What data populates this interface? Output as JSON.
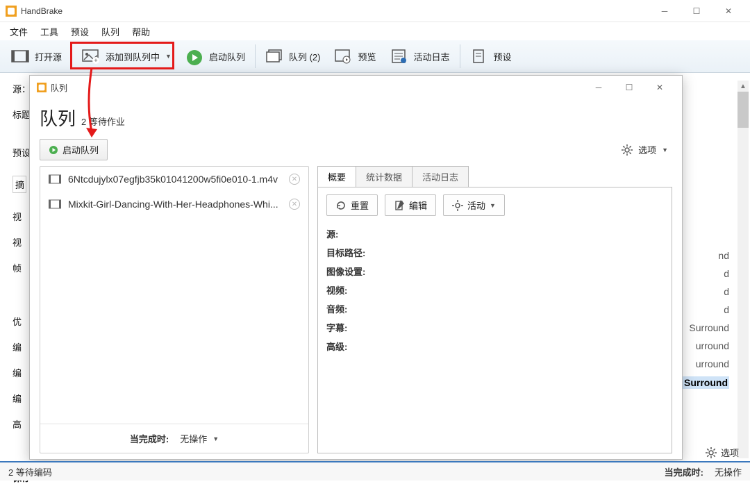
{
  "app": {
    "title": "HandBrake"
  },
  "menu": {
    "file": "文件",
    "tools": "工具",
    "presets": "预设",
    "queue": "队列",
    "help": "帮助"
  },
  "toolbar": {
    "open_source": "打开源",
    "add_to_queue": "添加到队列中",
    "start_queue": "启动队列",
    "queue_label": "队列 (2)",
    "preview": "预览",
    "activity_log": "活动日志",
    "presets": "预设"
  },
  "bg": {
    "source": "源：",
    "title": "标题",
    "preset": "预设",
    "summary_tab": "摘",
    "vid1": "视",
    "vid2": "视",
    "fps": "帧",
    "opt": "优",
    "enc1": "编",
    "enc2": "编",
    "enc3": "编",
    "adv": "高",
    "save": "保存"
  },
  "peek": [
    "nd",
    "d",
    "d",
    "d",
    "Surround",
    "urround",
    "urround",
    "Surround"
  ],
  "statusbar": {
    "pending": "2 等待编码",
    "when_done": "当完成时:",
    "action": "无操作"
  },
  "queue": {
    "window_title": "队列",
    "heading": "队列",
    "heading_sub": "2 等待作业",
    "start_btn": "启动队列",
    "options_btn": "选项",
    "items": [
      "6Ntcdujylx07egfjb35k01041200w5fi0e010-1.m4v",
      "Mixkit-Girl-Dancing-With-Her-Headphones-Whi..."
    ],
    "when_done_label": "当完成时:",
    "when_done_value": "无操作",
    "tabs": {
      "summary": "概要",
      "stats": "统计数据",
      "log": "活动日志"
    },
    "actions": {
      "reset": "重置",
      "edit": "编辑",
      "activity": "活动"
    },
    "fields": {
      "source": "源:",
      "dest": "目标路径:",
      "picture": "图像设置:",
      "video": "视频:",
      "audio": "音频:",
      "subs": "字幕:",
      "adv": "高级:"
    }
  },
  "options_label": "选项"
}
